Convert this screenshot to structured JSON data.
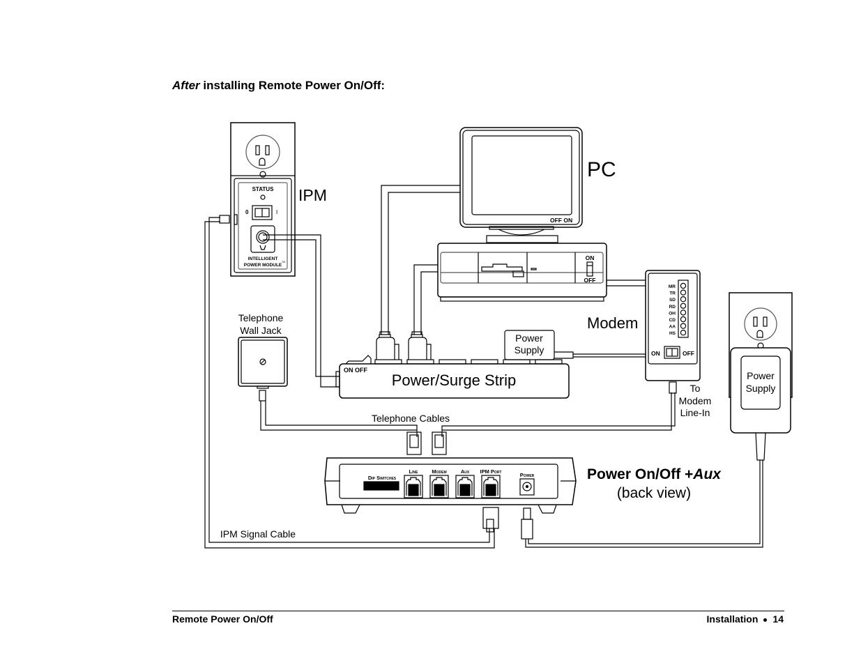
{
  "heading": {
    "italic": "After",
    "rest": " installing Remote Power On/Off:"
  },
  "labels": {
    "ipm": "IPM",
    "pc": "PC",
    "modem": "Modem",
    "telephone_wall_jack_line1": "Telephone",
    "telephone_wall_jack_line2": "Wall Jack",
    "power_surge_strip": "Power/Surge Strip",
    "strip_switch": "ON OFF",
    "strip_power_supply_line1": "Power",
    "strip_power_supply_line2": "Supply",
    "wall_power_supply_line1": "Power",
    "wall_power_supply_line2": "Supply",
    "telephone_cables": "Telephone Cables",
    "ipm_signal_cable": "IPM Signal Cable",
    "to_modem_line1": "To",
    "to_modem_line2": "Modem",
    "to_modem_line3": "Line-In",
    "device_title_bold": "Power On/Off +",
    "device_title_italic": "Aux",
    "device_subtitle": "(back view)"
  },
  "ipm_panel": {
    "status": "STATUS",
    "switch_off": "0",
    "switch_on": "I",
    "brand_line1": "Intelligent",
    "brand_line2": "Power Module",
    "tm": "TM"
  },
  "monitor": {
    "switch": "OFF ON"
  },
  "pc_case": {
    "switch_on": "ON",
    "switch_off": "OFF"
  },
  "modem_panel": {
    "leds": [
      "MR",
      "TR",
      "SD",
      "RD",
      "OH",
      "CD",
      "AA",
      "HS"
    ],
    "switch_on": "ON",
    "switch_off": "OFF"
  },
  "device_ports": {
    "dip_switches": "Dip Switches",
    "ports": [
      "Line",
      "Modem",
      "Aux",
      "IPM Port"
    ],
    "power": "Power"
  },
  "footer": {
    "left": "Remote Power On/Off",
    "section": "Installation",
    "page": "14"
  }
}
